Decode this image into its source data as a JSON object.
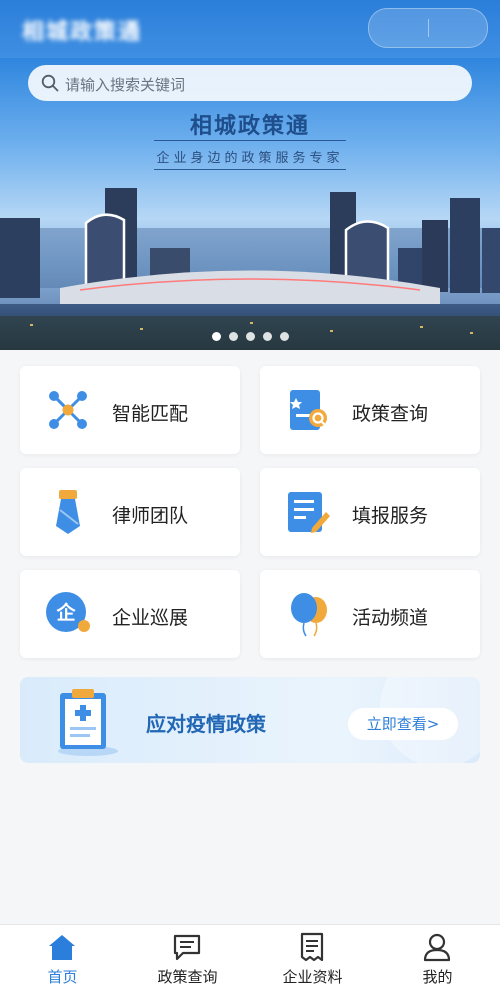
{
  "header": {
    "title": "相城政策通"
  },
  "search": {
    "placeholder": "请输入搜索关键词"
  },
  "banner": {
    "title": "相城政策通",
    "subtitle": "企业身边的政策服务专家",
    "page_count": 5,
    "active_index": 0
  },
  "features": [
    {
      "label": "智能匹配",
      "icon": "network-match-icon"
    },
    {
      "label": "政策查询",
      "icon": "document-search-icon"
    },
    {
      "label": "律师团队",
      "icon": "necktie-icon"
    },
    {
      "label": "填报服务",
      "icon": "form-edit-icon"
    },
    {
      "label": "企业巡展",
      "icon": "enterprise-badge-icon"
    },
    {
      "label": "活动频道",
      "icon": "balloons-icon"
    }
  ],
  "promo": {
    "title": "应对疫情政策",
    "button": "立即查看>"
  },
  "tabbar": {
    "active": 0,
    "items": [
      {
        "label": "首页",
        "icon": "home-icon"
      },
      {
        "label": "政策查询",
        "icon": "message-icon"
      },
      {
        "label": "企业资料",
        "icon": "receipt-icon"
      },
      {
        "label": "我的",
        "icon": "user-icon"
      }
    ]
  },
  "colors": {
    "primary": "#2b7ed9",
    "accent": "#f2a93b",
    "promo_text": "#2167b5"
  }
}
